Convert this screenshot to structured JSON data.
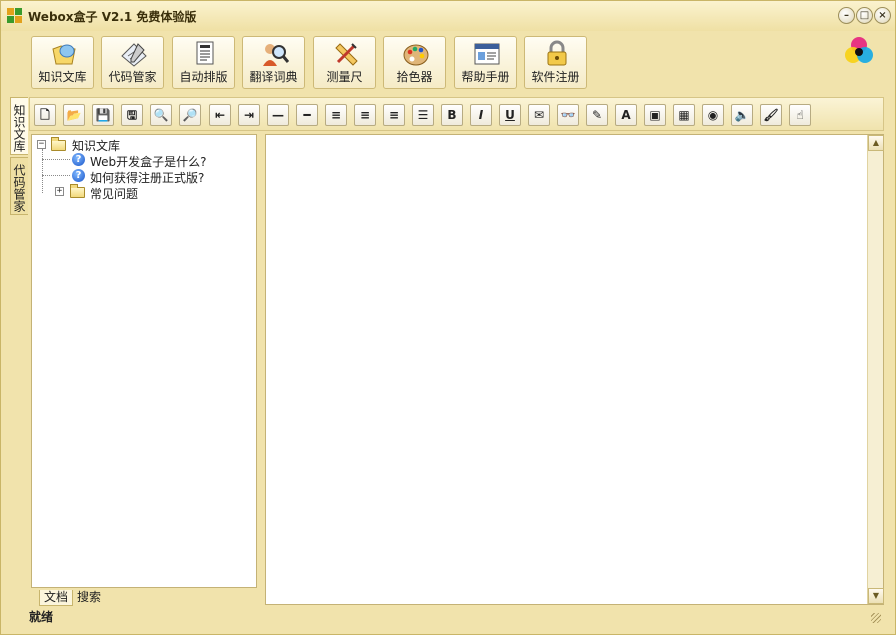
{
  "window": {
    "title": "Webox盒子 V2.1  免费体验版",
    "logo_icon": "webox-logo-icon",
    "controls": [
      {
        "name": "minimize-button",
        "glyph": "–"
      },
      {
        "name": "maximize-button",
        "glyph": "□"
      },
      {
        "name": "close-button",
        "glyph": "×"
      }
    ]
  },
  "main_toolbar": {
    "buttons": [
      {
        "label": "知识文库",
        "icon": "knowledge-library-icon"
      },
      {
        "label": "代码管家",
        "icon": "code-manager-icon"
      },
      {
        "label": "自动排版",
        "icon": "auto-format-icon"
      },
      {
        "label": "翻译词典",
        "icon": "dictionary-icon"
      },
      {
        "label": "测量尺",
        "icon": "ruler-icon"
      },
      {
        "label": "拾色器",
        "icon": "color-picker-icon"
      },
      {
        "label": "帮助手册",
        "icon": "help-manual-icon"
      },
      {
        "label": "软件注册",
        "icon": "register-lock-icon"
      }
    ],
    "brand_icon": "color-circles-logo-icon"
  },
  "side_tabs": [
    {
      "label": "知识文库",
      "active": true
    },
    {
      "label": "代码管家",
      "active": false
    }
  ],
  "format_toolbar": {
    "buttons": [
      {
        "name": "new-doc-icon",
        "glyph": "🗋"
      },
      {
        "name": "open-folder-icon",
        "glyph": "📂"
      },
      {
        "name": "save-icon",
        "glyph": "💾"
      },
      {
        "name": "save-as-icon",
        "glyph": "🖫"
      },
      {
        "name": "preview-icon",
        "glyph": "🔍"
      },
      {
        "name": "find-icon",
        "glyph": "🔎"
      },
      {
        "name": "outdent-icon",
        "glyph": "⇤"
      },
      {
        "name": "indent-icon",
        "glyph": "⇥"
      },
      {
        "name": "horizontal-rule-icon",
        "glyph": "—"
      },
      {
        "name": "horizontal-line-icon",
        "glyph": "━"
      },
      {
        "name": "align-left-icon",
        "glyph": "≡"
      },
      {
        "name": "align-center-icon",
        "glyph": "≡"
      },
      {
        "name": "align-right-icon",
        "glyph": "≡"
      },
      {
        "name": "justify-icon",
        "glyph": "☰"
      },
      {
        "name": "bold-icon",
        "glyph": "B"
      },
      {
        "name": "italic-icon",
        "glyph": "I"
      },
      {
        "name": "underline-icon",
        "glyph": "U"
      },
      {
        "name": "insert-link-icon",
        "glyph": "✉"
      },
      {
        "name": "binoculars-icon",
        "glyph": "👓"
      },
      {
        "name": "palette-icon",
        "glyph": "✎"
      },
      {
        "name": "font-color-icon",
        "glyph": "A"
      },
      {
        "name": "insert-image-icon",
        "glyph": "▣"
      },
      {
        "name": "insert-table-icon",
        "glyph": "▦"
      },
      {
        "name": "globe-icon",
        "glyph": "◉"
      },
      {
        "name": "sound-icon",
        "glyph": "🔈"
      },
      {
        "name": "brush-icon",
        "glyph": "🖌"
      },
      {
        "name": "hand-icon",
        "glyph": "☝"
      }
    ]
  },
  "tree": {
    "root": {
      "label": "知识文库",
      "expander": "−"
    },
    "items": [
      {
        "label": "Web开发盒子是什么?",
        "type": "doc"
      },
      {
        "label": "如何获得注册正式版?",
        "type": "doc"
      },
      {
        "label": "常见问题",
        "type": "folder",
        "expander": "+"
      }
    ]
  },
  "tree_tabs": [
    {
      "label": "文档",
      "active": true
    },
    {
      "label": "搜索",
      "active": false
    }
  ],
  "editor": {
    "content": "",
    "scroll_up": "▲",
    "scroll_down": "▼"
  },
  "status": {
    "text": "就绪"
  }
}
